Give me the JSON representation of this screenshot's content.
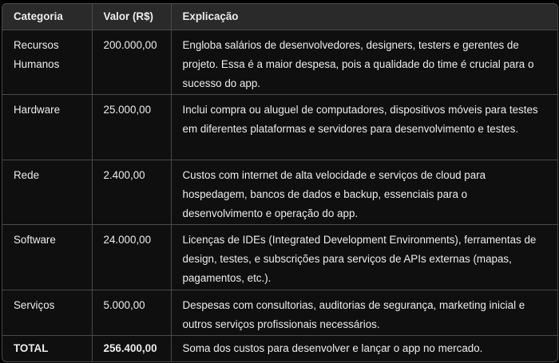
{
  "table": {
    "headers": [
      "Categoria",
      "Valor (R$)",
      "Explicação"
    ],
    "rows": [
      {
        "categoria": "Recursos Humanos",
        "valor": "200.000,00",
        "explicacao": "Engloba salários de desenvolvedores, designers, testers e gerentes de projeto. Essa é a maior despesa, pois a qualidade do time é crucial para o sucesso do app."
      },
      {
        "categoria": "Hardware",
        "valor": "25.000,00",
        "explicacao": "Inclui compra ou aluguel de computadores, dispositivos móveis para testes em diferentes plataformas e servidores para desenvolvimento e testes."
      },
      {
        "categoria": "Rede",
        "valor": "2.400,00",
        "explicacao": "Custos com internet de alta velocidade e serviços de cloud para hospedagem, bancos de dados e backup, essenciais para o desenvolvimento e operação do app."
      },
      {
        "categoria": "Software",
        "valor": "24.000,00",
        "explicacao": "Licenças de IDEs (Integrated Development Environments), ferramentas de design, testes, e subscrições para serviços de APIs externas (mapas, pagamentos, etc.)."
      },
      {
        "categoria": "Serviços",
        "valor": "5.000,00",
        "explicacao": "Despesas com consultorias, auditorias de segurança, marketing inicial e outros serviços profissionais necessários."
      },
      {
        "categoria": "TOTAL",
        "valor": "256.400,00",
        "explicacao": "Soma dos custos para desenvolver e lançar o app no mercado."
      }
    ]
  }
}
